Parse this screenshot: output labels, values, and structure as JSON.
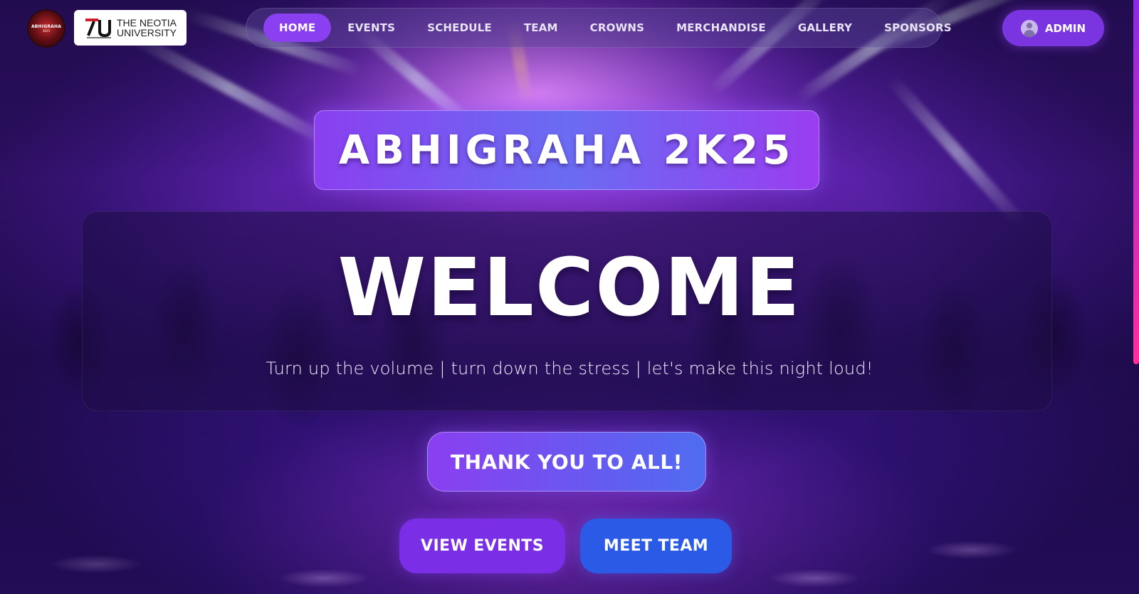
{
  "colors": {
    "accent_purple": "#8a3ff0",
    "accent_blue": "#2a5ae6",
    "scrollbar_gradient_end": "#ff2f9a"
  },
  "header": {
    "fest_logo": {
      "icon": "abhigraha-logo",
      "text": "ABHIGRAHA",
      "subtext": "2K25"
    },
    "university_logo": {
      "icon": "neotia-university-logo",
      "line1": "THE NEOTIA",
      "line2": "UNIVERSITY"
    },
    "nav": {
      "items": [
        {
          "label": "HOME",
          "active": true
        },
        {
          "label": "EVENTS",
          "active": false
        },
        {
          "label": "SCHEDULE",
          "active": false
        },
        {
          "label": "TEAM",
          "active": false
        },
        {
          "label": "CROWNS",
          "active": false
        },
        {
          "label": "MERCHANDISE",
          "active": false
        },
        {
          "label": "GALLERY",
          "active": false
        },
        {
          "label": "SPONSORS",
          "active": false
        }
      ]
    },
    "admin": {
      "label": "ADMIN",
      "icon": "user-avatar-icon"
    }
  },
  "hero": {
    "event_title": "ABHIGRAHA 2K25",
    "welcome": "WELCOME",
    "tagline": "Turn up the volume | turn down the stress | let's make this night loud!",
    "thanks_button": "THANK YOU TO ALL!",
    "view_events_button": "VIEW EVENTS",
    "meet_team_button": "MEET TEAM"
  }
}
